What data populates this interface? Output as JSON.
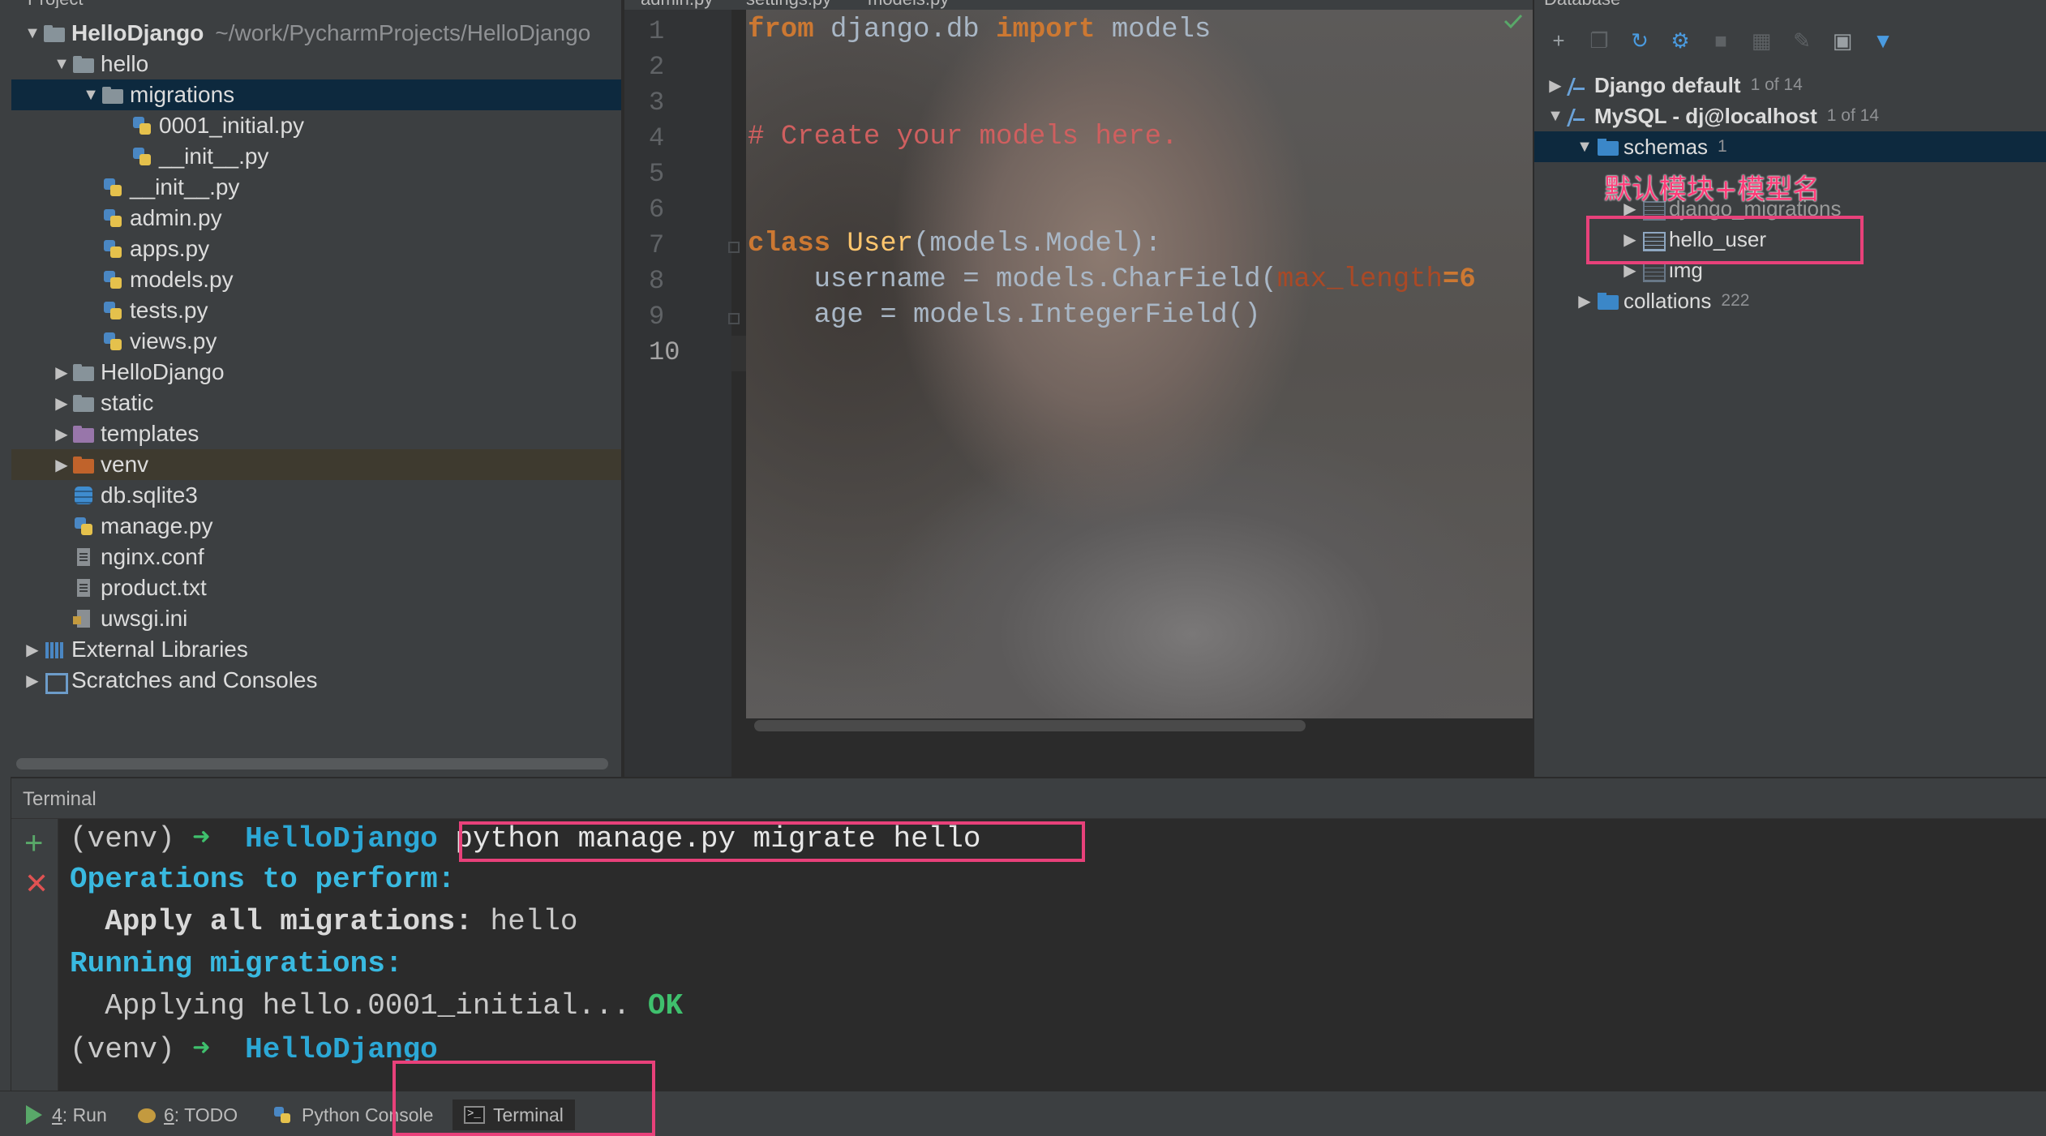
{
  "project": {
    "header": "Project",
    "tree": [
      {
        "label": "HelloDjango",
        "path": "~/work/PycharmProjects/HelloDjango",
        "icon": "folder-icon",
        "depth": 0,
        "expanded": true
      },
      {
        "label": "hello",
        "icon": "folder-icon",
        "depth": 1,
        "expanded": true
      },
      {
        "label": "migrations",
        "icon": "folder-icon",
        "depth": 2,
        "expanded": true,
        "selected": true
      },
      {
        "label": "0001_initial.py",
        "icon": "python-file-icon",
        "depth": 3
      },
      {
        "label": "__init__.py",
        "icon": "python-file-icon",
        "depth": 3
      },
      {
        "label": "__init__.py",
        "icon": "python-file-icon",
        "depth": 2
      },
      {
        "label": "admin.py",
        "icon": "python-file-icon",
        "depth": 2
      },
      {
        "label": "apps.py",
        "icon": "python-file-icon",
        "depth": 2
      },
      {
        "label": "models.py",
        "icon": "python-file-icon",
        "depth": 2
      },
      {
        "label": "tests.py",
        "icon": "python-file-icon",
        "depth": 2
      },
      {
        "label": "views.py",
        "icon": "python-file-icon",
        "depth": 2
      },
      {
        "label": "HelloDjango",
        "icon": "folder-icon",
        "depth": 1,
        "expanded": false
      },
      {
        "label": "static",
        "icon": "folder-icon",
        "depth": 1,
        "expanded": false
      },
      {
        "label": "templates",
        "icon": "folder-icon",
        "depth": 1,
        "expanded": false
      },
      {
        "label": "venv",
        "icon": "folder-icon",
        "depth": 1,
        "expanded": false
      },
      {
        "label": "db.sqlite3",
        "icon": "database-file-icon",
        "depth": 1
      },
      {
        "label": "manage.py",
        "icon": "python-file-icon",
        "depth": 1
      },
      {
        "label": "nginx.conf",
        "icon": "text-file-icon",
        "depth": 1
      },
      {
        "label": "product.txt",
        "icon": "text-file-icon",
        "depth": 1
      },
      {
        "label": "uwsgi.ini",
        "icon": "ini-file-icon",
        "depth": 1
      },
      {
        "label": "External Libraries",
        "icon": "library-icon",
        "depth": 0,
        "expanded": false
      },
      {
        "label": "Scratches and Consoles",
        "icon": "scratch-icon",
        "depth": 0,
        "expanded": false
      }
    ]
  },
  "editor": {
    "tabs": [
      "admin.py",
      "settings.py",
      "models.py"
    ],
    "active_tab": "models.py",
    "line_numbers": [
      "1",
      "2",
      "3",
      "4",
      "5",
      "6",
      "7",
      "8",
      "9",
      "10"
    ],
    "current_line": "10",
    "code": {
      "l1_kw1": "from",
      "l1_mod": " django.db ",
      "l1_kw2": "import",
      "l1_rest": " models",
      "l4_comment": "# Create your models here.",
      "l7_kw": "class",
      "l7_cls": " User",
      "l7_rest": "(models.Model):",
      "l8_a": "    username = models.CharField(",
      "l8_param": "max_length",
      "l8_b": "=6",
      "l9": "    age = models.IntegerField()"
    }
  },
  "database": {
    "header": "Database",
    "connections": [
      {
        "label": "Django default",
        "count": "1 of 14",
        "expanded": false
      },
      {
        "label": "MySQL - dj@localhost",
        "count": "1 of 14",
        "expanded": true
      }
    ],
    "schemas": {
      "label": "schemas",
      "count": "1"
    },
    "tables": [
      "django_migrations",
      "hello_user",
      "img"
    ],
    "collations": {
      "label": "collations",
      "count": "222"
    },
    "annotation": "默认模块+模型名"
  },
  "terminal": {
    "title": "Terminal",
    "prompt_venv": "(venv)",
    "prompt_arrow": "➜",
    "prompt_dir": "HelloDjango",
    "command": "python manage.py migrate hello",
    "out_ops": "Operations to perform:",
    "out_apply_label": "  Apply all migrations:",
    "out_apply_value": " hello",
    "out_running": "Running migrations:",
    "out_applying": "  Applying hello.0001_initial...",
    "out_ok": " OK"
  },
  "bottom_bar": {
    "run_num": "4",
    "run_label": ": Run",
    "todo_num": "6",
    "todo_label": ": TODO",
    "python_console": "Python Console",
    "terminal": "Terminal"
  },
  "colors": {
    "background": "#2b2b2b",
    "panel": "#3c3f41",
    "selection": "#0d293e",
    "keyword": "#cc7832",
    "annotation": "#e8417a"
  }
}
